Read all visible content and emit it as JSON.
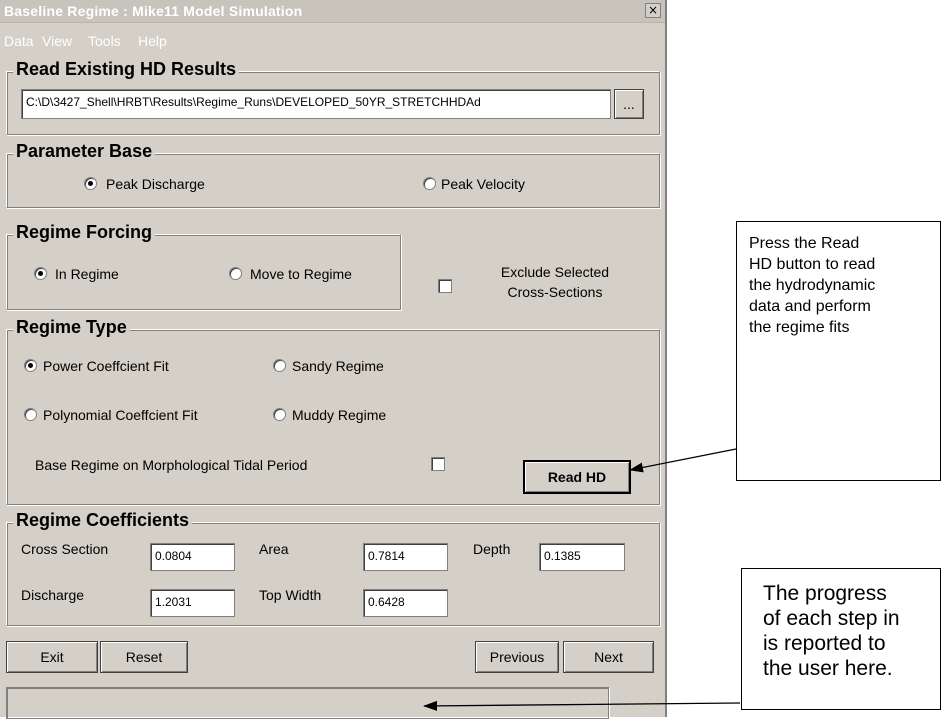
{
  "window": {
    "title": "Baseline Regime : Mike11 Model Simulation",
    "close_glyph": "×",
    "menu": [
      "Data",
      "View",
      "Tools",
      "Help"
    ]
  },
  "read_existing": {
    "legend": "Read Existing HD Results",
    "path": "C:\\D\\3427_Shell\\HRBT\\Results\\Regime_Runs\\DEVELOPED_50YR_STRETCHHDAd",
    "browse_label": "..."
  },
  "parameter_base": {
    "legend": "Parameter Base",
    "options": [
      "Peak Discharge",
      "Peak Velocity"
    ],
    "selected": "Peak Discharge"
  },
  "regime_forcing": {
    "legend": "Regime Forcing",
    "options": [
      "In Regime",
      "Move to Regime"
    ],
    "selected": "In Regime",
    "exclude_label_line1": "Exclude Selected",
    "exclude_label_line2": "Cross-Sections",
    "exclude_checked": false
  },
  "regime_type": {
    "legend": "Regime Type",
    "options": [
      "Power Coeffcient Fit",
      "Sandy Regime",
      "Polynomial Coeffcient Fit",
      "Muddy Regime"
    ],
    "selected": "Power Coeffcient Fit",
    "morph_label": "Base Regime on Morphological Tidal Period",
    "morph_checked": false,
    "read_hd_label": "Read HD"
  },
  "regime_coefficients": {
    "legend": "Regime Coefficients",
    "cross_section": {
      "label": "Cross Section",
      "value": "0.0804"
    },
    "area": {
      "label": "Area",
      "value": "0.7814"
    },
    "depth": {
      "label": "Depth",
      "value": "0.1385"
    },
    "discharge": {
      "label": "Discharge",
      "value": "1.2031"
    },
    "top_width": {
      "label": "Top Width",
      "value": "0.6428"
    }
  },
  "buttons": {
    "exit": "Exit",
    "reset": "Reset",
    "previous": "Previous",
    "next": "Next"
  },
  "status_text": "",
  "callouts": {
    "read_hd_note": [
      "Press the Read",
      "HD button to read",
      "the hydrodynamic",
      "data and perform",
      "the regime fits"
    ],
    "progress_note": [
      "The progress",
      "of each step in",
      "is reported to",
      "the user here."
    ]
  },
  "colors": {
    "dialog_bg": "#d4d0c8",
    "title_bar": "#c8c4bc",
    "title_text": "#ffffff"
  }
}
